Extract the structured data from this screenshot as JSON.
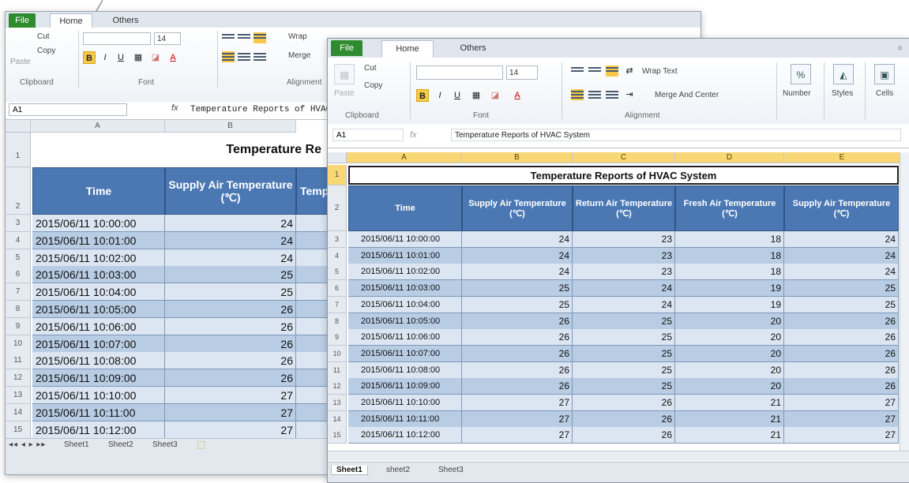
{
  "ribbon": {
    "tabs": [
      "File",
      "Home",
      "Others"
    ],
    "clipboard": {
      "paste": "Paste",
      "cut": "Cut",
      "copy": "Copy",
      "label": "Clipboard"
    },
    "font": {
      "size": "14",
      "bold": "B",
      "italic": "I",
      "underline": "U",
      "label": "Font"
    },
    "alignment": {
      "wrap_text": "Wrap Text",
      "merge_and_center": "Merge And Center",
      "label": "Alignment"
    },
    "number": "Number",
    "styles": "Styles",
    "cells": "Cells"
  },
  "back_window": {
    "wrap_text": "Wrap",
    "merge": "Merge",
    "name_box": "A1",
    "formula": "Temperature Reports of HVAC System",
    "title_visible": "Temperature Re",
    "columns": [
      "A",
      "B"
    ],
    "headers": [
      "Time",
      "Supply Air Temperature (℃)",
      "Temp"
    ],
    "sheet_tabs": [
      "Sheet1",
      "Sheet2",
      "Sheet3"
    ]
  },
  "front_window": {
    "name_box": "A1",
    "formula": "Temperature Reports of HVAC System",
    "title": "Temperature Reports of HVAC System",
    "columns": [
      "A",
      "B",
      "C",
      "D",
      "E"
    ],
    "headers": [
      "Time",
      "Supply Air Temperature (℃)",
      "Return Air Temperature (℃)",
      "Fresh Air Temperature (℃)",
      "Supply Air Temperature (℃)"
    ],
    "sheet_tabs": [
      "Sheet1",
      "sheet2",
      "Sheet3"
    ]
  },
  "rows": [
    {
      "n": "3",
      "time": "2015/06/11 10:00:00",
      "supply": "24",
      "ret": "23",
      "fresh": "18",
      "supply2": "24"
    },
    {
      "n": "4",
      "time": "2015/06/11 10:01:00",
      "supply": "24",
      "ret": "23",
      "fresh": "18",
      "supply2": "24"
    },
    {
      "n": "5",
      "time": "2015/06/11 10:02:00",
      "supply": "24",
      "ret": "23",
      "fresh": "18",
      "supply2": "24"
    },
    {
      "n": "6",
      "time": "2015/06/11 10:03:00",
      "supply": "25",
      "ret": "24",
      "fresh": "19",
      "supply2": "25"
    },
    {
      "n": "7",
      "time": "2015/06/11 10:04:00",
      "supply": "25",
      "ret": "24",
      "fresh": "19",
      "supply2": "25"
    },
    {
      "n": "8",
      "time": "2015/06/11 10:05:00",
      "supply": "26",
      "ret": "25",
      "fresh": "20",
      "supply2": "26"
    },
    {
      "n": "9",
      "time": "2015/06/11 10:06:00",
      "supply": "26",
      "ret": "25",
      "fresh": "20",
      "supply2": "26"
    },
    {
      "n": "10",
      "time": "2015/06/11 10:07:00",
      "supply": "26",
      "ret": "25",
      "fresh": "20",
      "supply2": "26"
    },
    {
      "n": "11",
      "time": "2015/06/11 10:08:00",
      "supply": "26",
      "ret": "25",
      "fresh": "20",
      "supply2": "26"
    },
    {
      "n": "12",
      "time": "2015/06/11 10:09:00",
      "supply": "26",
      "ret": "25",
      "fresh": "20",
      "supply2": "26"
    },
    {
      "n": "13",
      "time": "2015/06/11 10:10:00",
      "supply": "27",
      "ret": "26",
      "fresh": "21",
      "supply2": "27"
    },
    {
      "n": "14",
      "time": "2015/06/11 10:11:00",
      "supply": "27",
      "ret": "26",
      "fresh": "21",
      "supply2": "27"
    },
    {
      "n": "15",
      "time": "2015/06/11 10:12:00",
      "supply": "27",
      "ret": "26",
      "fresh": "21",
      "supply2": "27"
    }
  ]
}
